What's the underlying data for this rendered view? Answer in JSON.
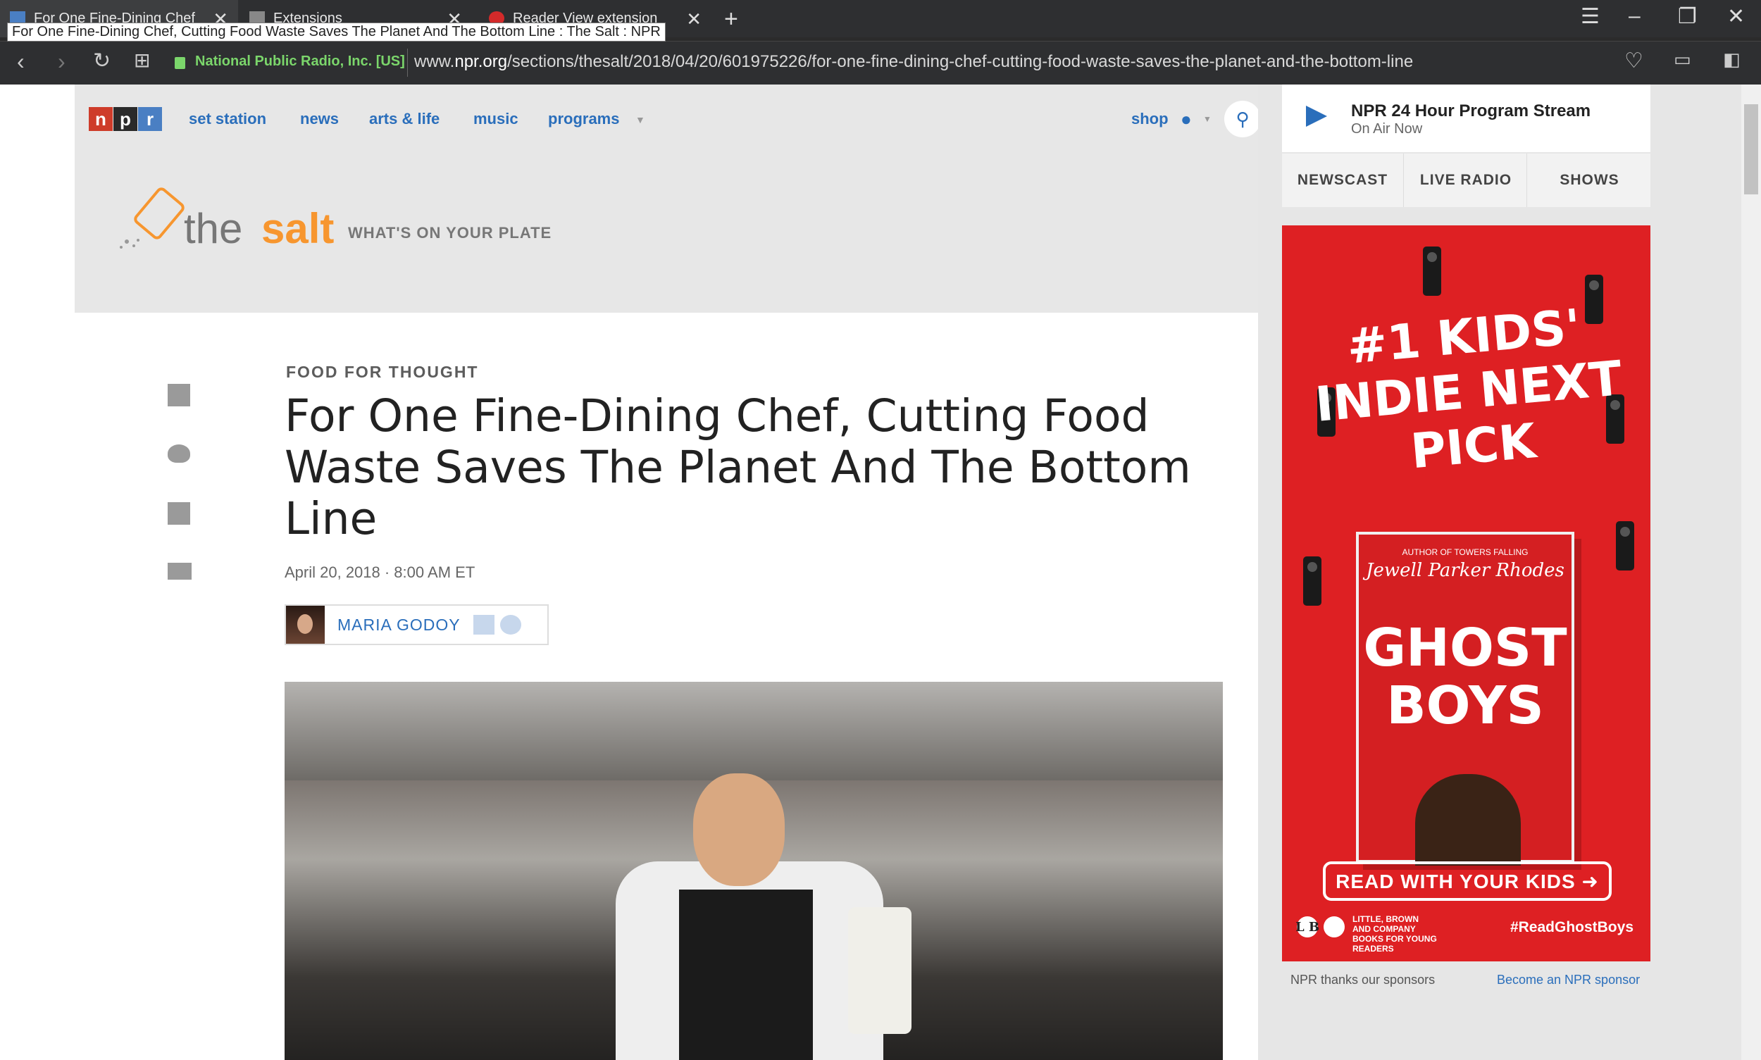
{
  "browser": {
    "tabs": [
      {
        "label": "For One Fine-Dining Chef"
      },
      {
        "label": "Extensions"
      },
      {
        "label": "Reader View extension"
      }
    ],
    "tooltip": "For One Fine-Dining Chef, Cutting Food Waste Saves The Planet And The Bottom Line : The Salt : NPR",
    "security_label": "National Public Radio, Inc. [US]",
    "url_prefix": "www.",
    "url_domain": "npr.org",
    "url_path": "/sections/thesalt/2018/04/20/601975226/for-one-fine-dining-chef-cutting-food-waste-saves-the-planet-and-the-bottom-line"
  },
  "npr_nav": {
    "logo_letters": [
      "n",
      "p",
      "r"
    ],
    "logo_colors": [
      "#ce3c2a",
      "#2a2a2a",
      "#4a7fc3"
    ],
    "links": [
      "set station",
      "news",
      "arts & life",
      "music",
      "programs"
    ],
    "shop": "shop"
  },
  "salt": {
    "the": "the",
    "salt": "salt",
    "tagline": "WHAT'S ON YOUR PLATE"
  },
  "article": {
    "kicker": "FOOD FOR THOUGHT",
    "headline": "For One Fine-Dining Chef, Cutting Food Waste Saves The Planet And The Bottom Line",
    "date": "April 20, 2018 · 8:00 AM ET",
    "author": "MARIA GODOY"
  },
  "sidebar": {
    "stream_title": "NPR 24 Hour Program Stream",
    "stream_sub": "On Air Now",
    "tabs": [
      "NEWSCAST",
      "LIVE RADIO",
      "SHOWS"
    ],
    "ad": {
      "headline": "#1 KIDS' INDIE NEXT PICK",
      "book_author_line": "AUTHOR OF TOWERS FALLING",
      "book_author": "Jewell Parker Rhodes",
      "book_title": "GHOST BOYS",
      "cta": "READ WITH YOUR KIDS ➜",
      "publisher": "LITTLE, BROWN AND COMPANY BOOKS FOR YOUNG READERS",
      "publisher_logo": "L B",
      "hashtag": "#ReadGhostBoys"
    },
    "sponsor_text": "NPR thanks our sponsors",
    "sponsor_link": "Become an NPR sponsor"
  }
}
